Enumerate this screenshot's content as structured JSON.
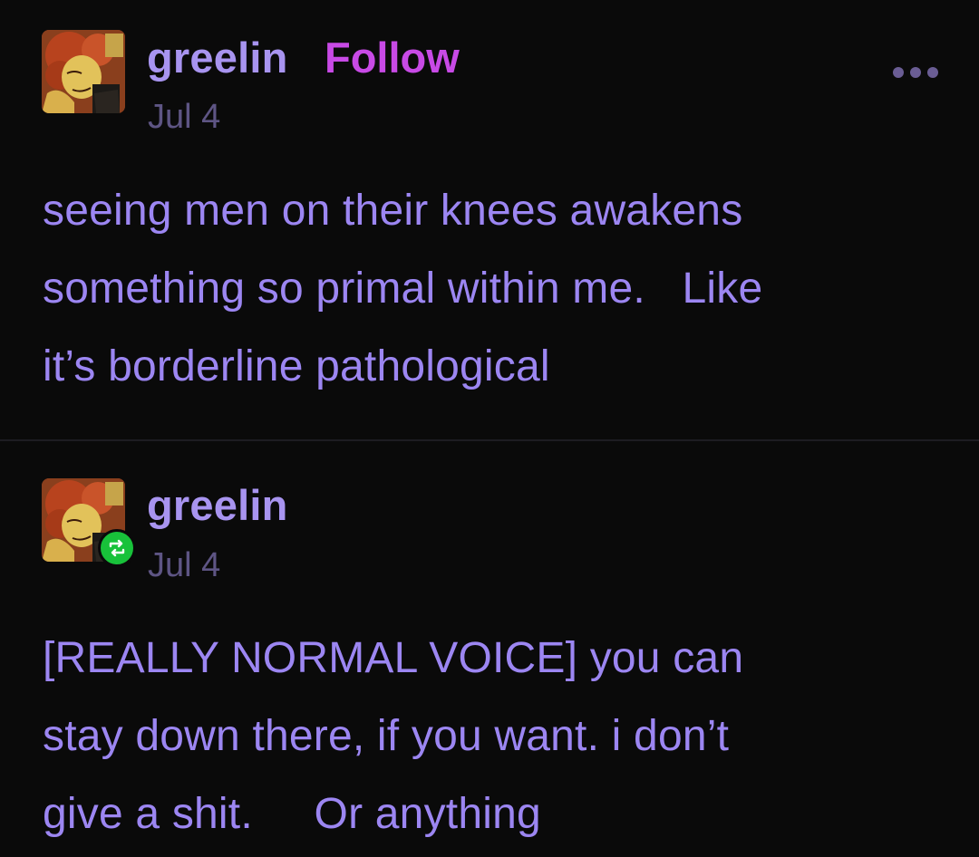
{
  "posts": [
    {
      "username": "greelin",
      "follow_label": "Follow",
      "date": "Jul 4",
      "lines": [
        "seeing men on their knees awakens",
        "something so primal within me.   Like",
        "it’s borderline pathological"
      ],
      "avatar_icon": "avatar-portrait",
      "menu_icon": "more-options-icon"
    },
    {
      "username": "greelin",
      "date": "Jul 4",
      "reblog_icon": "reblog-icon",
      "lines": [
        "[REALLY NORMAL VOICE] you can",
        "stay down there, if you want. i don’t",
        "give a shit.     Or anything"
      ]
    }
  ],
  "colors": {
    "background": "#0a0a0a",
    "username": "#a894f0",
    "follow": "#c84ae6",
    "date": "#5e5584",
    "body_text": "#9c86f2",
    "reblog_badge": "#18c23a"
  }
}
